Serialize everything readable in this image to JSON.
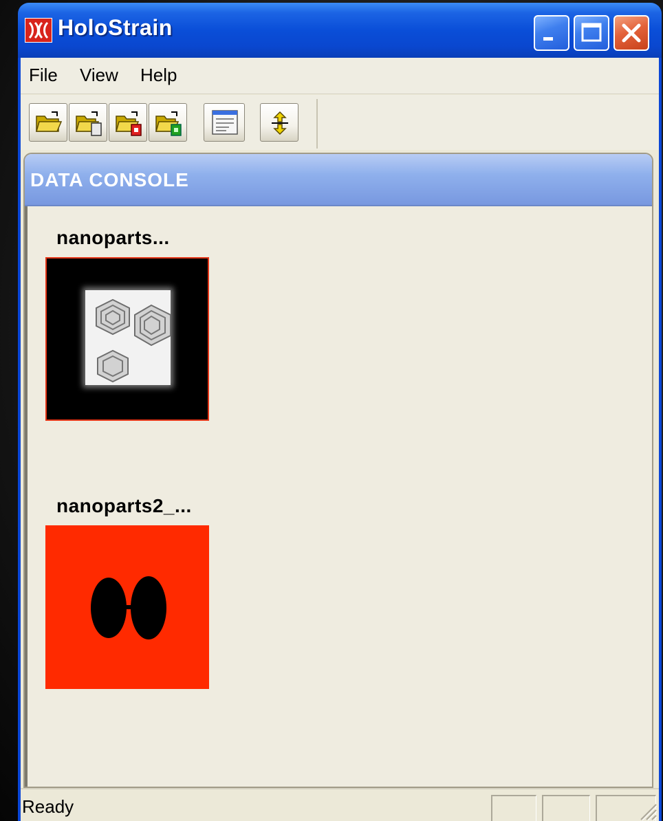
{
  "window": {
    "title": "HoloStrain",
    "app_icon": "holostrain-logo-icon"
  },
  "titlebar_buttons": {
    "minimize": "minimize-icon",
    "maximize": "maximize-icon",
    "close": "close-icon"
  },
  "menu": {
    "items": [
      "File",
      "View",
      "Help"
    ]
  },
  "toolbar": {
    "buttons": [
      {
        "name": "open-folder-icon"
      },
      {
        "name": "open-folder-file-icon"
      },
      {
        "name": "open-folder-red-icon"
      },
      {
        "name": "open-folder-green-icon"
      },
      {
        "name": "window-list-icon"
      },
      {
        "name": "yellow-arrows-icon"
      }
    ]
  },
  "console": {
    "title": "DATA CONSOLE",
    "items": [
      {
        "label": "nanoparts..."
      },
      {
        "label": "nanoparts2_..."
      }
    ]
  },
  "status": {
    "text": "Ready"
  },
  "colors": {
    "titlebar": "#0a4ed8",
    "panel_header": "#8fb0ec",
    "thumbnail_border": "#e43416",
    "thumbnail_red": "#ff2a00"
  }
}
